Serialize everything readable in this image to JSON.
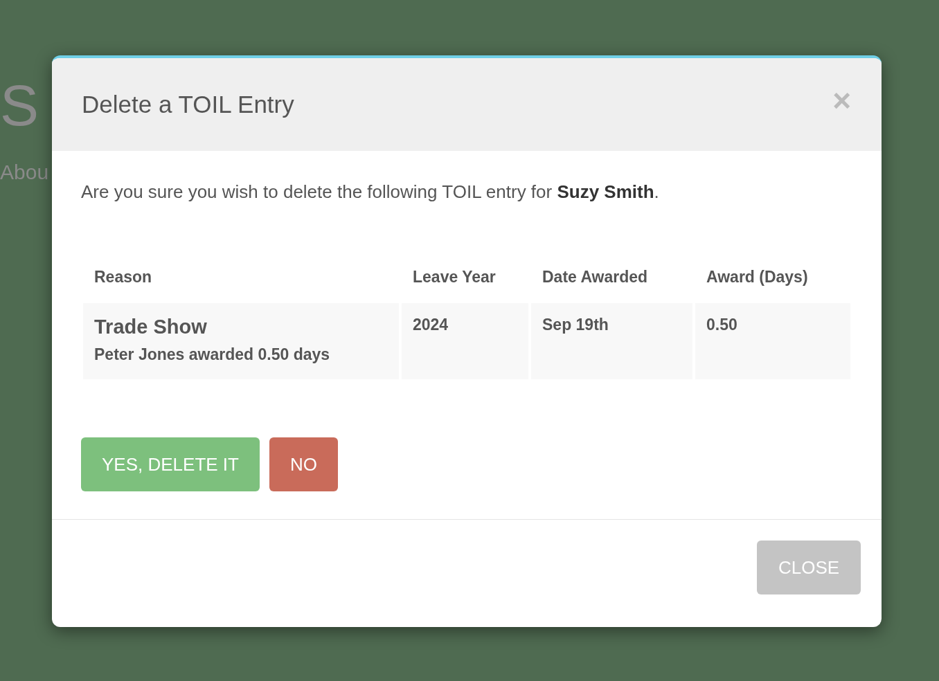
{
  "background": {
    "title": "S",
    "subtitle": "Abou"
  },
  "modal": {
    "title": "Delete a TOIL Entry",
    "close_icon": "×",
    "message": "Are you sure you wish to delete the following TOIL entry for **Suzy Smith**.",
    "table": {
      "columns": [
        "Reason",
        "Leave Year",
        "Date Awarded",
        "Award (Days)"
      ],
      "rows": [
        {
          "reason": "Trade Show",
          "note": "Peter Jones awarded 0.50 days",
          "leave_year": "2024",
          "date_awarded": "Sep 19th",
          "award": "0.50"
        }
      ]
    },
    "actions": [
      {
        "label": "YES, DELETE IT",
        "kind": "confirm"
      },
      {
        "label": "NO",
        "kind": "cancel"
      }
    ],
    "footer_button": "CLOSE"
  }
}
